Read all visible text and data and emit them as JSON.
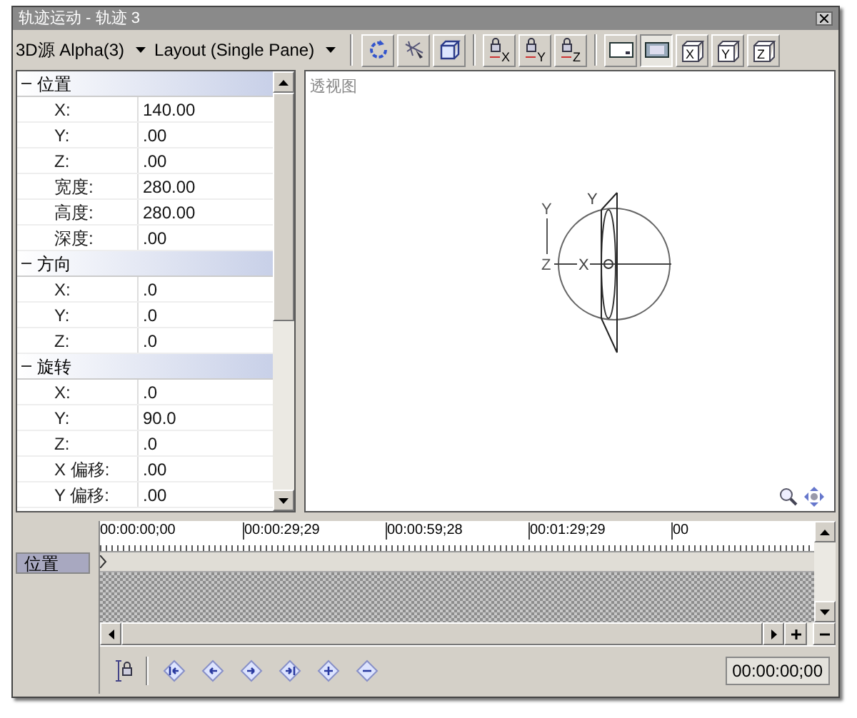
{
  "window": {
    "title": "轨迹运动 - 轨迹 3"
  },
  "toolbar": {
    "source": "3D源 Alpha(3)",
    "layout": "Layout (Single Pane)",
    "buttons": [
      {
        "kind": "rotate"
      },
      {
        "kind": "move"
      },
      {
        "kind": "cube"
      },
      {
        "kind": "sep"
      },
      {
        "kind": "lock",
        "axis": "X"
      },
      {
        "kind": "lock",
        "axis": "Y"
      },
      {
        "kind": "lock",
        "axis": "Z"
      },
      {
        "kind": "sep"
      },
      {
        "kind": "frame",
        "selected": false
      },
      {
        "kind": "frame",
        "selected": true
      },
      {
        "kind": "axisbox",
        "axis": "X"
      },
      {
        "kind": "axisbox",
        "axis": "Y"
      },
      {
        "kind": "axisbox",
        "axis": "Z"
      }
    ]
  },
  "properties": [
    {
      "name": "位置",
      "expanded": true,
      "rows": [
        {
          "label": "X:",
          "value": "140.00"
        },
        {
          "label": "Y:",
          "value": ".00"
        },
        {
          "label": "Z:",
          "value": ".00"
        },
        {
          "label": "宽度:",
          "value": "280.00"
        },
        {
          "label": "高度:",
          "value": "280.00"
        },
        {
          "label": "深度:",
          "value": ".00"
        }
      ]
    },
    {
      "name": "方向",
      "expanded": true,
      "rows": [
        {
          "label": "X:",
          "value": ".0"
        },
        {
          "label": "Y:",
          "value": ".0"
        },
        {
          "label": "Z:",
          "value": ".0"
        }
      ]
    },
    {
      "name": "旋转",
      "expanded": true,
      "rows": [
        {
          "label": "X:",
          "value": ".0"
        },
        {
          "label": "Y:",
          "value": "90.0"
        },
        {
          "label": "Z:",
          "value": ".0"
        },
        {
          "label": "X 偏移:",
          "value": ".00"
        },
        {
          "label": "Y 偏移:",
          "value": ".00"
        }
      ]
    }
  ],
  "viewport": {
    "label": "透视图",
    "axis_labels": {
      "y2": "Y",
      "y": "Y",
      "z": "Z",
      "x": "X"
    }
  },
  "timeline": {
    "tracks": [
      {
        "name": "位置",
        "selected": true
      }
    ],
    "ruler": [
      "00:00:00;00",
      "00:00:29;29",
      "00:00:59;28",
      "00:01:29;29",
      "00"
    ],
    "keyframe_buttons": [
      {
        "kind": "first"
      },
      {
        "kind": "prev"
      },
      {
        "kind": "next"
      },
      {
        "kind": "last"
      },
      {
        "kind": "add"
      },
      {
        "kind": "remove"
      }
    ],
    "time": "00:00:00;00"
  }
}
